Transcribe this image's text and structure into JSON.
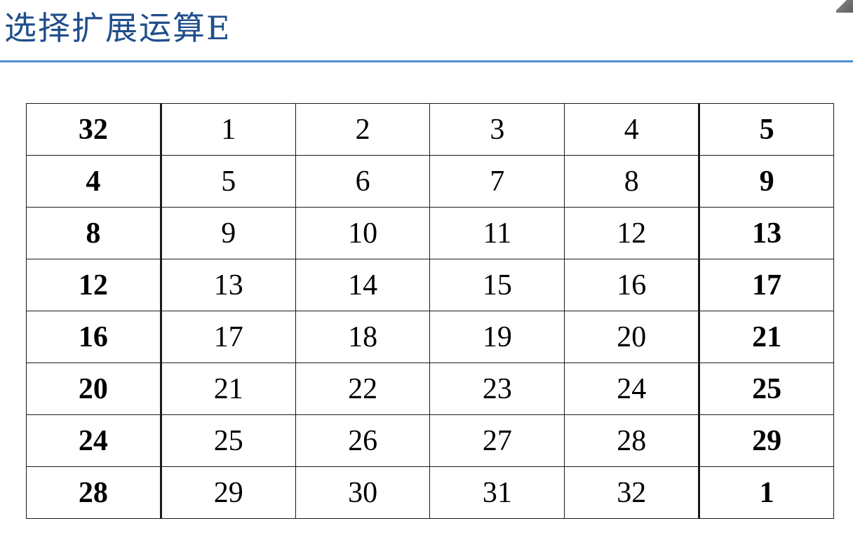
{
  "title": "选择扩展运算E",
  "colors": {
    "title": "#1f4e8c",
    "rule": "#4f8fd6"
  },
  "table": {
    "rows": [
      [
        "32",
        "1",
        "2",
        "3",
        "4",
        "5"
      ],
      [
        "4",
        "5",
        "6",
        "7",
        "8",
        "9"
      ],
      [
        "8",
        "9",
        "10",
        "11",
        "12",
        "13"
      ],
      [
        "12",
        "13",
        "14",
        "15",
        "16",
        "17"
      ],
      [
        "16",
        "17",
        "18",
        "19",
        "20",
        "21"
      ],
      [
        "20",
        "21",
        "22",
        "23",
        "24",
        "25"
      ],
      [
        "24",
        "25",
        "26",
        "27",
        "28",
        "29"
      ],
      [
        "28",
        "29",
        "30",
        "31",
        "32",
        "1"
      ]
    ],
    "bold_columns": [
      0,
      5
    ]
  }
}
